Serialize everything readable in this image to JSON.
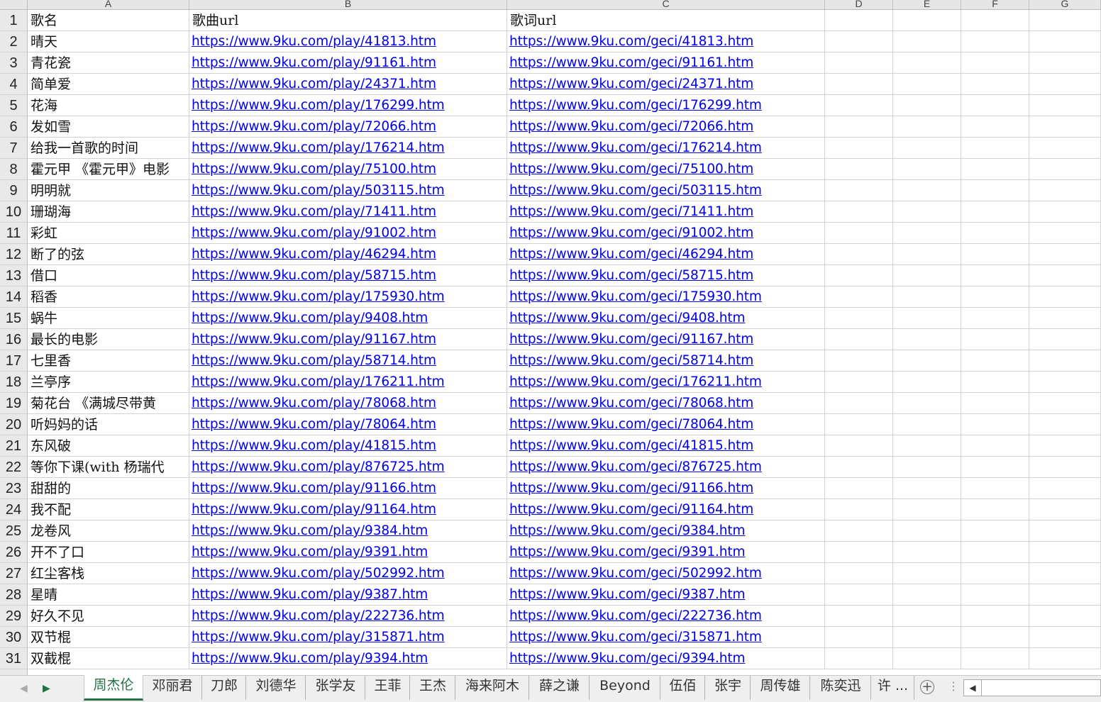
{
  "columns": [
    "A",
    "B",
    "C",
    "D",
    "E",
    "F",
    "G"
  ],
  "rows": [
    {
      "num": "1",
      "name": "歌名",
      "song": "歌曲url",
      "lyric": "歌词url"
    },
    {
      "num": "2",
      "name": "晴天",
      "song": "https://www.9ku.com/play/41813.htm",
      "lyric": "https://www.9ku.com/geci/41813.htm"
    },
    {
      "num": "3",
      "name": "青花瓷",
      "song": "https://www.9ku.com/play/91161.htm",
      "lyric": "https://www.9ku.com/geci/91161.htm"
    },
    {
      "num": "4",
      "name": "简单爱",
      "song": "https://www.9ku.com/play/24371.htm",
      "lyric": "https://www.9ku.com/geci/24371.htm"
    },
    {
      "num": "5",
      "name": "花海",
      "song": "https://www.9ku.com/play/176299.htm",
      "lyric": "https://www.9ku.com/geci/176299.htm"
    },
    {
      "num": "6",
      "name": "发如雪",
      "song": "https://www.9ku.com/play/72066.htm",
      "lyric": "https://www.9ku.com/geci/72066.htm"
    },
    {
      "num": "7",
      "name": "给我一首歌的时间",
      "song": "https://www.9ku.com/play/176214.htm",
      "lyric": "https://www.9ku.com/geci/176214.htm"
    },
    {
      "num": "8",
      "name": "霍元甲 《霍元甲》电影",
      "song": "https://www.9ku.com/play/75100.htm",
      "lyric": "https://www.9ku.com/geci/75100.htm"
    },
    {
      "num": "9",
      "name": "明明就",
      "song": "https://www.9ku.com/play/503115.htm",
      "lyric": "https://www.9ku.com/geci/503115.htm"
    },
    {
      "num": "10",
      "name": "珊瑚海",
      "song": "https://www.9ku.com/play/71411.htm",
      "lyric": "https://www.9ku.com/geci/71411.htm"
    },
    {
      "num": "11",
      "name": "彩虹",
      "song": "https://www.9ku.com/play/91002.htm",
      "lyric": "https://www.9ku.com/geci/91002.htm"
    },
    {
      "num": "12",
      "name": "断了的弦",
      "song": "https://www.9ku.com/play/46294.htm",
      "lyric": "https://www.9ku.com/geci/46294.htm"
    },
    {
      "num": "13",
      "name": "借口",
      "song": "https://www.9ku.com/play/58715.htm",
      "lyric": "https://www.9ku.com/geci/58715.htm"
    },
    {
      "num": "14",
      "name": "稻香",
      "song": "https://www.9ku.com/play/175930.htm",
      "lyric": "https://www.9ku.com/geci/175930.htm"
    },
    {
      "num": "15",
      "name": "蜗牛",
      "song": "https://www.9ku.com/play/9408.htm",
      "lyric": "https://www.9ku.com/geci/9408.htm"
    },
    {
      "num": "16",
      "name": "最长的电影",
      "song": "https://www.9ku.com/play/91167.htm",
      "lyric": "https://www.9ku.com/geci/91167.htm"
    },
    {
      "num": "17",
      "name": "七里香",
      "song": "https://www.9ku.com/play/58714.htm",
      "lyric": "https://www.9ku.com/geci/58714.htm"
    },
    {
      "num": "18",
      "name": "兰亭序",
      "song": "https://www.9ku.com/play/176211.htm",
      "lyric": "https://www.9ku.com/geci/176211.htm"
    },
    {
      "num": "19",
      "name": "菊花台 《满城尽带黄",
      "song": "https://www.9ku.com/play/78068.htm",
      "lyric": "https://www.9ku.com/geci/78068.htm"
    },
    {
      "num": "20",
      "name": "听妈妈的话",
      "song": "https://www.9ku.com/play/78064.htm",
      "lyric": "https://www.9ku.com/geci/78064.htm"
    },
    {
      "num": "21",
      "name": "东风破",
      "song": "https://www.9ku.com/play/41815.htm",
      "lyric": "https://www.9ku.com/geci/41815.htm"
    },
    {
      "num": "22",
      "name": "等你下课(with 杨瑞代",
      "song": "https://www.9ku.com/play/876725.htm",
      "lyric": "https://www.9ku.com/geci/876725.htm"
    },
    {
      "num": "23",
      "name": "甜甜的",
      "song": "https://www.9ku.com/play/91166.htm",
      "lyric": "https://www.9ku.com/geci/91166.htm"
    },
    {
      "num": "24",
      "name": "我不配",
      "song": "https://www.9ku.com/play/91164.htm",
      "lyric": "https://www.9ku.com/geci/91164.htm"
    },
    {
      "num": "25",
      "name": "龙卷风",
      "song": "https://www.9ku.com/play/9384.htm",
      "lyric": "https://www.9ku.com/geci/9384.htm"
    },
    {
      "num": "26",
      "name": "开不了口",
      "song": "https://www.9ku.com/play/9391.htm",
      "lyric": "https://www.9ku.com/geci/9391.htm"
    },
    {
      "num": "27",
      "name": "红尘客栈",
      "song": "https://www.9ku.com/play/502992.htm",
      "lyric": "https://www.9ku.com/geci/502992.htm"
    },
    {
      "num": "28",
      "name": "星晴",
      "song": "https://www.9ku.com/play/9387.htm",
      "lyric": "https://www.9ku.com/geci/9387.htm"
    },
    {
      "num": "29",
      "name": "好久不见",
      "song": "https://www.9ku.com/play/222736.htm",
      "lyric": "https://www.9ku.com/geci/222736.htm"
    },
    {
      "num": "30",
      "name": "双节棍",
      "song": "https://www.9ku.com/play/315871.htm",
      "lyric": "https://www.9ku.com/geci/315871.htm"
    },
    {
      "num": "31",
      "name": "双截棍",
      "song": "https://www.9ku.com/play/9394.htm",
      "lyric": "https://www.9ku.com/geci/9394.htm"
    }
  ],
  "sheet_tabs": [
    "周杰伦",
    "邓丽君",
    "刀郎",
    "刘德华",
    "张学友",
    "王菲",
    "王杰",
    "海来阿木",
    "薛之谦",
    "Beyond",
    "伍佰",
    "张宇",
    "周传雄",
    "陈奕迅",
    "许 ..."
  ],
  "active_tab": "周杰伦",
  "nav": {
    "prev": "◀",
    "next": "▶"
  },
  "add_sheet_label": "+",
  "more_label": "⋮",
  "scroll_left_label": "◀",
  "colors": {
    "link": "#0000ee",
    "active_tab": "#217346",
    "header_bg": "#e6e6e6"
  }
}
